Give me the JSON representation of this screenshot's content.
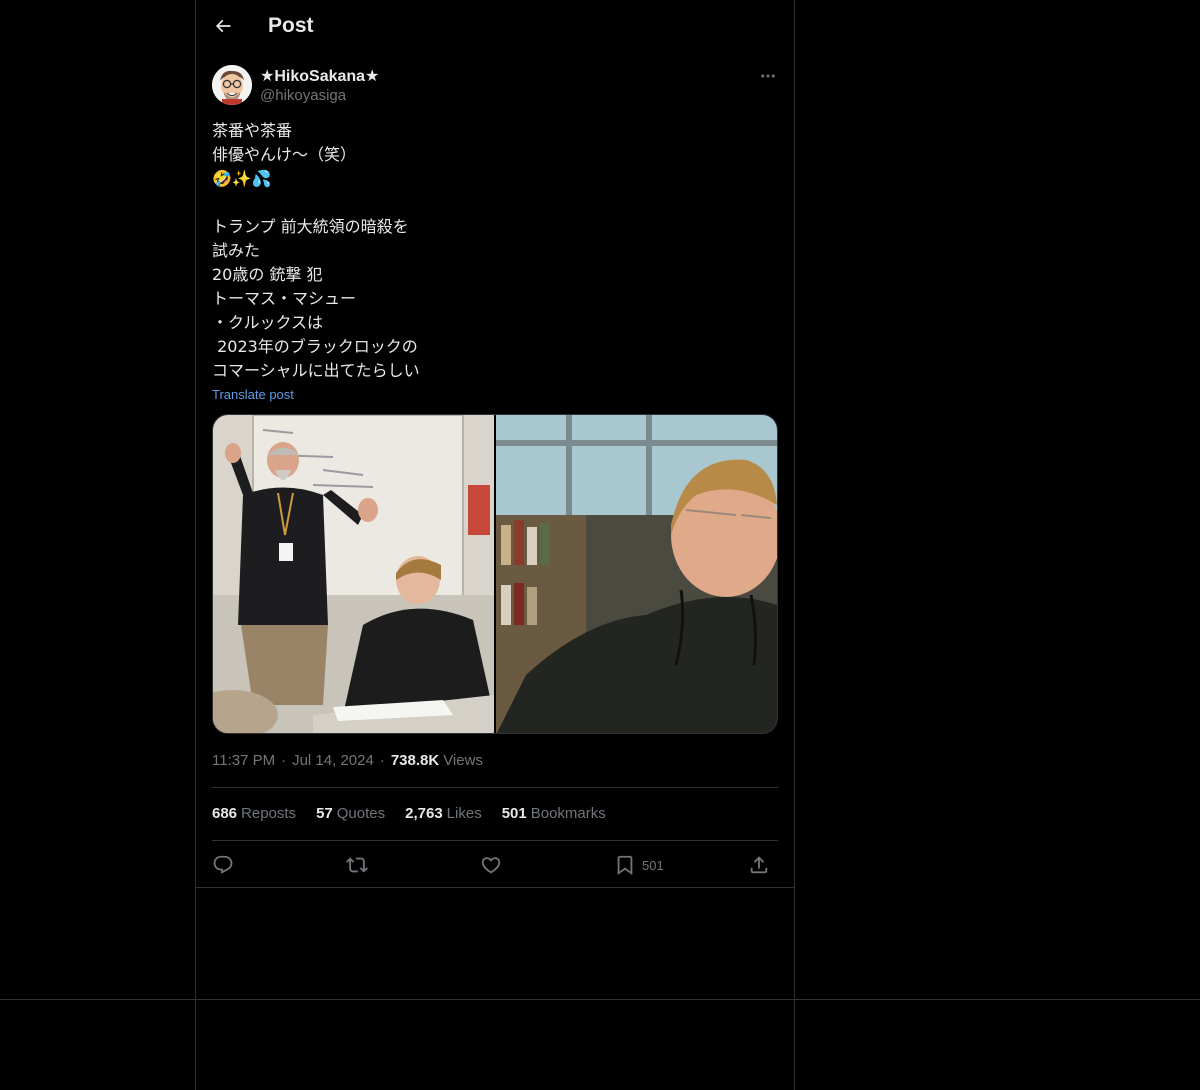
{
  "header": {
    "title": "Post"
  },
  "author": {
    "display_name": "★HikoSakana★",
    "handle": "@hikoyasiga"
  },
  "post": {
    "lines": [
      "茶番や茶番",
      "俳優やんけ〜（笑）",
      "🤣✨💦",
      "",
      "トランプ 前大統領の暗殺を",
      "試みた",
      "20歳の 銃撃 犯",
      "トーマス・マシュー",
      "・クルックスは",
      " 2023年のブラックロックの",
      "コマーシャルに出てたらしい"
    ],
    "translate_label": "Translate post"
  },
  "meta": {
    "time": "11:37 PM",
    "date": "Jul 14, 2024",
    "views_count": "738.8K",
    "views_label": "Views"
  },
  "stats": {
    "reposts_count": "686",
    "reposts_label": "Reposts",
    "quotes_count": "57",
    "quotes_label": "Quotes",
    "likes_count": "2,763",
    "likes_label": "Likes",
    "bookmarks_count": "501",
    "bookmarks_label": "Bookmarks"
  },
  "actions": {
    "bookmark_count": "501"
  },
  "colors": {
    "background": "#000000",
    "border": "#2f3336",
    "text_primary": "#e7e9ea",
    "text_secondary": "#71767b",
    "link": "#5f9ce4"
  }
}
